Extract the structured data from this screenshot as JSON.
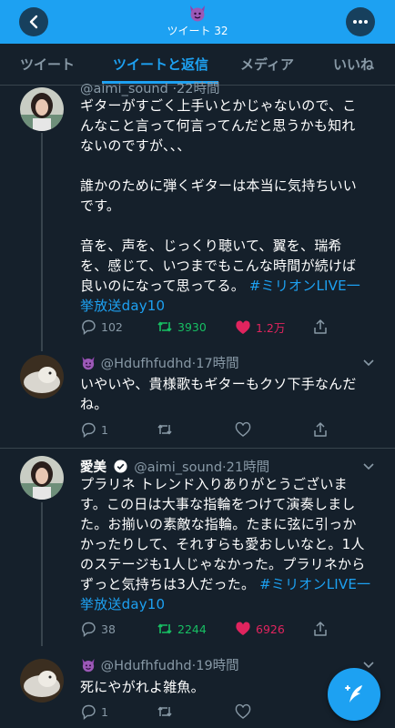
{
  "header": {
    "title": "ツイート 32",
    "icon": "devil-emoji-icon",
    "color": "#1da1f2"
  },
  "tabs": [
    {
      "label": "ツイート",
      "active": false
    },
    {
      "label": "ツイートと返信",
      "active": true
    },
    {
      "label": "メディア",
      "active": false
    },
    {
      "label": "いいね",
      "active": false
    }
  ],
  "tweets": [
    {
      "name": "",
      "handle": "@aimi_sound",
      "time": "22時間",
      "lines": [
        "ギターがすごく上手いとかじゃないので、こ",
        "んなこと言って何言ってんだと思うかも知れ",
        "ないのですが、、、",
        "",
        "誰かのために弾くギターは本当に気持ちいい",
        "です。",
        "",
        "音を、声を、じっくり聴いて、翼を、瑞希",
        "を、感じて、いつまでもこんな時間が続けば",
        "良いのになって思ってる。"
      ],
      "hashtag_inline": "#ミリオンLIVE一",
      "hashtag_tail": "挙放送day10",
      "replies": "102",
      "retweets": "3930",
      "likes": "1.2万"
    },
    {
      "handle": "@Hdufhfudhd",
      "time": "17時間",
      "lines": [
        "いやいや、貴様歌もギターもクソ下手なんだ",
        "ね。"
      ],
      "replies": "1",
      "retweets": "",
      "likes": ""
    },
    {
      "name": "愛美",
      "handle": "@aimi_sound",
      "time": "21時間",
      "lines": [
        "プラリネ トレンド入りありがとうございま",
        "す。この日は大事な指輪をつけて演奏しまし",
        "た。お揃いの素敵な指輪。たまに弦に引っか",
        "かったりして、それすらも愛おしいなと。1人",
        "のステージも1人じゃなかった。プラリネから",
        "ずっと気持ちは3人だった。"
      ],
      "hashtag_inline": "#ミリオンLIVE一",
      "hashtag_tail": "挙放送day10",
      "replies": "38",
      "retweets": "2244",
      "likes": "6926"
    },
    {
      "handle": "@Hdufhfudhd",
      "time": "19時間",
      "lines": [
        "死にやがれよ雑魚。"
      ],
      "replies": "1",
      "retweets": "",
      "likes": ""
    }
  ],
  "compose_icon": "compose-tweet-icon"
}
